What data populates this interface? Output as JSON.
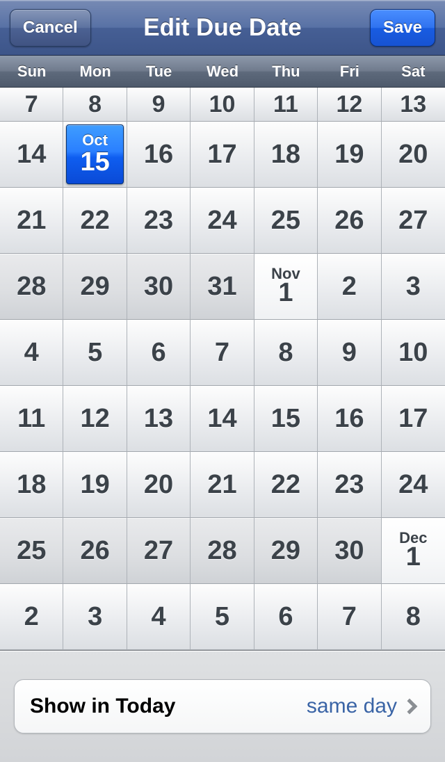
{
  "header": {
    "title": "Edit Due Date",
    "cancel_label": "Cancel",
    "save_label": "Save"
  },
  "weekdays": [
    "Sun",
    "Mon",
    "Tue",
    "Wed",
    "Thu",
    "Fri",
    "Sat"
  ],
  "calendar": {
    "selected_month": "Oct",
    "selected_day": "15",
    "rows": [
      [
        {
          "day": "7",
          "dim": false
        },
        {
          "day": "8",
          "dim": false
        },
        {
          "day": "9",
          "dim": false
        },
        {
          "day": "10",
          "dim": false
        },
        {
          "day": "11",
          "dim": false
        },
        {
          "day": "12",
          "dim": false
        },
        {
          "day": "13",
          "dim": false
        }
      ],
      [
        {
          "day": "14",
          "dim": false
        },
        {
          "day": "15",
          "dim": false,
          "selected": true,
          "month": "Oct"
        },
        {
          "day": "16",
          "dim": false
        },
        {
          "day": "17",
          "dim": false
        },
        {
          "day": "18",
          "dim": false
        },
        {
          "day": "19",
          "dim": false
        },
        {
          "day": "20",
          "dim": false
        }
      ],
      [
        {
          "day": "21",
          "dim": false
        },
        {
          "day": "22",
          "dim": false
        },
        {
          "day": "23",
          "dim": false
        },
        {
          "day": "24",
          "dim": false
        },
        {
          "day": "25",
          "dim": false
        },
        {
          "day": "26",
          "dim": false
        },
        {
          "day": "27",
          "dim": false
        }
      ],
      [
        {
          "day": "28",
          "dim": true
        },
        {
          "day": "29",
          "dim": true
        },
        {
          "day": "30",
          "dim": true
        },
        {
          "day": "31",
          "dim": true
        },
        {
          "day": "1",
          "dim": false,
          "month": "Nov",
          "newmonth": true
        },
        {
          "day": "2",
          "dim": false
        },
        {
          "day": "3",
          "dim": false
        }
      ],
      [
        {
          "day": "4",
          "dim": false
        },
        {
          "day": "5",
          "dim": false
        },
        {
          "day": "6",
          "dim": false
        },
        {
          "day": "7",
          "dim": false
        },
        {
          "day": "8",
          "dim": false
        },
        {
          "day": "9",
          "dim": false
        },
        {
          "day": "10",
          "dim": false
        }
      ],
      [
        {
          "day": "11",
          "dim": false
        },
        {
          "day": "12",
          "dim": false
        },
        {
          "day": "13",
          "dim": false
        },
        {
          "day": "14",
          "dim": false
        },
        {
          "day": "15",
          "dim": false
        },
        {
          "day": "16",
          "dim": false
        },
        {
          "day": "17",
          "dim": false
        }
      ],
      [
        {
          "day": "18",
          "dim": false
        },
        {
          "day": "19",
          "dim": false
        },
        {
          "day": "20",
          "dim": false
        },
        {
          "day": "21",
          "dim": false
        },
        {
          "day": "22",
          "dim": false
        },
        {
          "day": "23",
          "dim": false
        },
        {
          "day": "24",
          "dim": false
        }
      ],
      [
        {
          "day": "25",
          "dim": true
        },
        {
          "day": "26",
          "dim": true
        },
        {
          "day": "27",
          "dim": true
        },
        {
          "day": "28",
          "dim": true
        },
        {
          "day": "29",
          "dim": true
        },
        {
          "day": "30",
          "dim": true
        },
        {
          "day": "1",
          "dim": false,
          "month": "Dec",
          "newmonth": true
        }
      ],
      [
        {
          "day": "2",
          "dim": false
        },
        {
          "day": "3",
          "dim": false
        },
        {
          "day": "4",
          "dim": false
        },
        {
          "day": "5",
          "dim": false
        },
        {
          "day": "6",
          "dim": false
        },
        {
          "day": "7",
          "dim": false
        },
        {
          "day": "8",
          "dim": false
        }
      ]
    ]
  },
  "bottom": {
    "label": "Show in Today",
    "value": "same day"
  }
}
